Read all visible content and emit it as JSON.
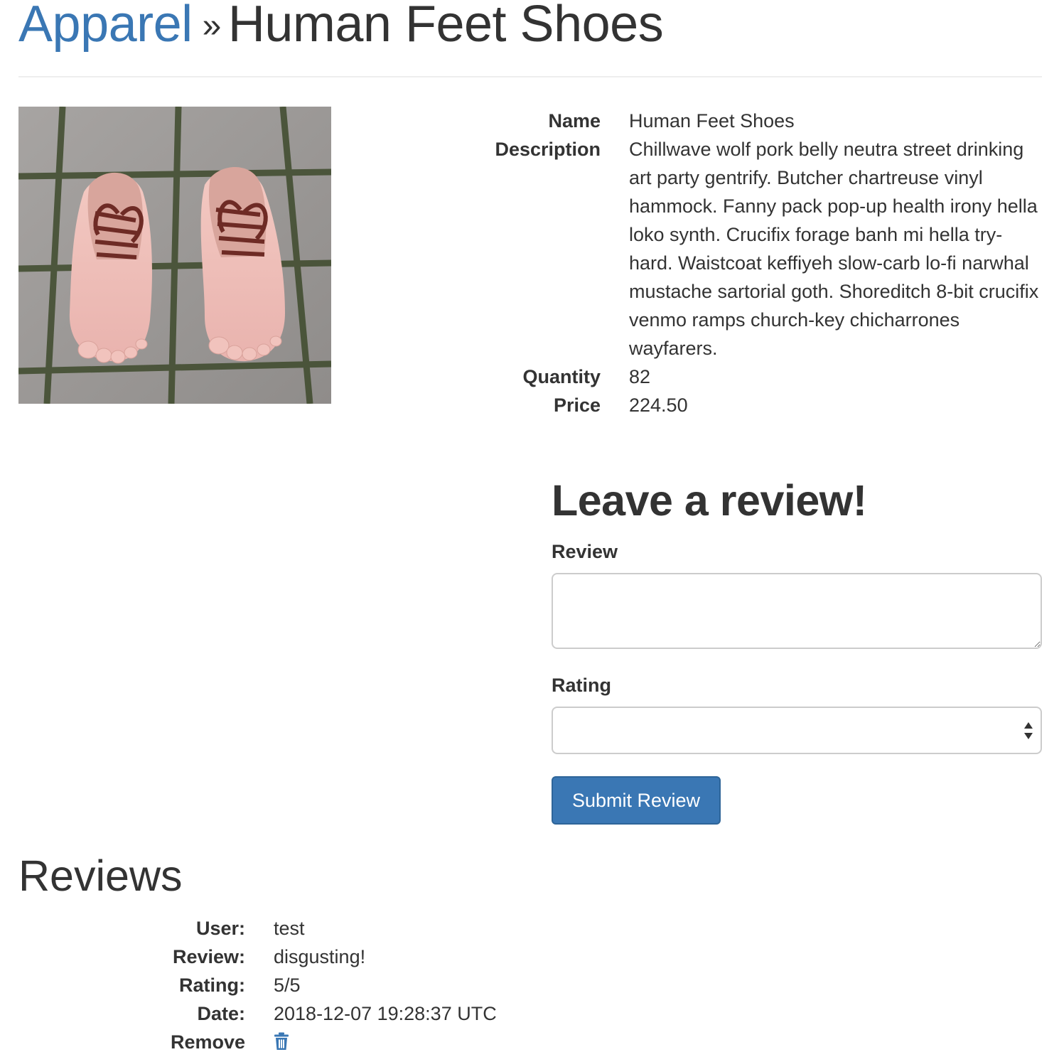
{
  "header": {
    "category": "Apparel",
    "separator": "»",
    "product_title": "Human Feet Shoes"
  },
  "product": {
    "name_label": "Name",
    "name": "Human Feet Shoes",
    "description_label": "Description",
    "description": "Chillwave wolf pork belly neutra street drinking art party gentrify. Butcher chartreuse vinyl hammock. Fanny pack pop-up health irony hella loko synth. Crucifix forage banh mi hella try-hard. Waistcoat keffiyeh slow-carb lo-fi narwhal mustache sartorial goth. Shoreditch 8-bit crucifix venmo ramps church-key chicharrones wayfarers.",
    "quantity_label": "Quantity",
    "quantity": "82",
    "price_label": "Price",
    "price": "224.50"
  },
  "review_form": {
    "title": "Leave a review!",
    "review_label": "Review",
    "review_value": "",
    "rating_label": "Rating",
    "rating_value": "",
    "submit_label": "Submit Review"
  },
  "reviews": {
    "title": "Reviews",
    "items": [
      {
        "user_label": "User:",
        "user": "test",
        "review_label": "Review:",
        "review": "disgusting!",
        "rating_label": "Rating:",
        "rating": "5/5",
        "date_label": "Date:",
        "date": "2018-12-07 19:28:37 UTC",
        "remove_label": "Remove",
        "remove_icon": "trash-icon"
      }
    ]
  },
  "colors": {
    "link": "#3a77b4",
    "button": "#3a77b4",
    "text": "#333333"
  }
}
